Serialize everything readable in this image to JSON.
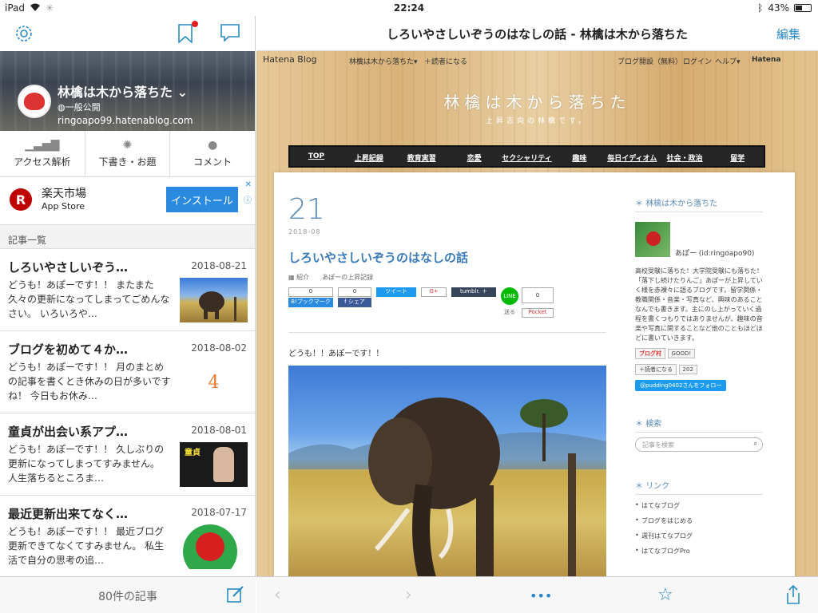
{
  "status": {
    "device": "iPad",
    "time": "22:24",
    "battery": "43%"
  },
  "left": {
    "blog_title": "林檎は木から落ちた",
    "visibility": "一般公開",
    "url": "ringoapo99.hatenablog.com",
    "actions": [
      {
        "label": "アクセス解析"
      },
      {
        "label": "下書き・お題"
      },
      {
        "label": "コメント"
      }
    ],
    "ad": {
      "name": "楽天市場",
      "store": "App Store",
      "button": "インストール",
      "logo": "R"
    },
    "section_label": "記事一覧",
    "articles": [
      {
        "title": "しろいやさしいぞう…",
        "date": "2018-08-21",
        "excerpt": "どうも！あぽーです！！ またまた久々の更新になってしまってごめんなさい。 いろいろや…"
      },
      {
        "title": "ブログを初めて４か…",
        "date": "2018-08-02",
        "excerpt": "どうも！あぽーです！！ 月のまとめの記事を書くとき休みの日が多いですね！ 今日もお休み…"
      },
      {
        "title": "童貞が出会い系アプ…",
        "date": "2018-08-01",
        "excerpt": "どうも！あぽーです！！ 久しぶりの更新になってしまってすみません。 人生落ちるところま…"
      },
      {
        "title": "最近更新出来てなく…",
        "date": "2018-07-17",
        "excerpt": "どうも！あぽーです！！ 最近ブログ更新できてなくてすみません。 私生活で自分の思考の追…"
      }
    ],
    "thumb_text": {
      "four": "4",
      "doutei": "童貞"
    },
    "article_count": "80件の記事"
  },
  "right": {
    "title": "しろいやさしいぞうのはなしの話 - 林檎は木から落ちた",
    "edit": "編集",
    "hatena_bar": {
      "logo": "Hatena Blog",
      "blog_menu": "林檎は木から落ちた▾",
      "reader": "＋読者になる",
      "open": "ブログ開設（無料）",
      "login": "ログイン",
      "help": "ヘルプ▾",
      "hatena": "Hatena"
    },
    "site_title": "林檎は木から落ちた",
    "site_sub": "上昇志向の林檎です。",
    "nav": [
      "TOP",
      "上昇記録",
      "教育実習",
      "恋愛",
      "セクシャリティ",
      "趣味",
      "毎日イディオム",
      "社会・政治",
      "留学"
    ],
    "post": {
      "day": "21",
      "ym": "2018-08",
      "title": "しろいやさしいぞうのはなしの話",
      "cats": "紹介　　あぽーの上昇記録",
      "greeting": "どうも！！あぽーです！！",
      "shares": {
        "hb_count": "0",
        "hb_label": "B!ブックマーク",
        "fb_count": "0",
        "fb_label": "f シェア",
        "tweet": "ツイート",
        "gplus": "G+",
        "tumblr": "tumblr. ＋",
        "line": "LINE",
        "line_send": "送る",
        "pocket_count": "0",
        "pocket": "Pocket"
      }
    },
    "sidebar": {
      "profile_head": "林檎は木から落ちた",
      "name": "あぽー (id:ringoapo90)",
      "bio": "高校受験に落ちた！大学院受験にも落ちた！「落下し続けたりんご」あぽーが上昇していく様を赤裸々に語るブログです。留学関係・教職関係・音楽・写真など、興味のあることなんでも書きます。主にのし上がっていく過程を書くつもりではありませんが、趣味の音楽や写真に関することなど他のこともほどほどに書いていきます。",
      "blogmura": "ブログ村",
      "good": "GOOD!",
      "reader_btn": "＋読者になる",
      "reader_count": "202",
      "follow": "@pudding0402さんをフォロー",
      "search_head": "検索",
      "search_placeholder": "記事を検索",
      "links_head": "リンク",
      "links": [
        "はてなブログ",
        "ブログをはじめる",
        "週刊はてなブログ",
        "はてなブログPro"
      ]
    }
  }
}
